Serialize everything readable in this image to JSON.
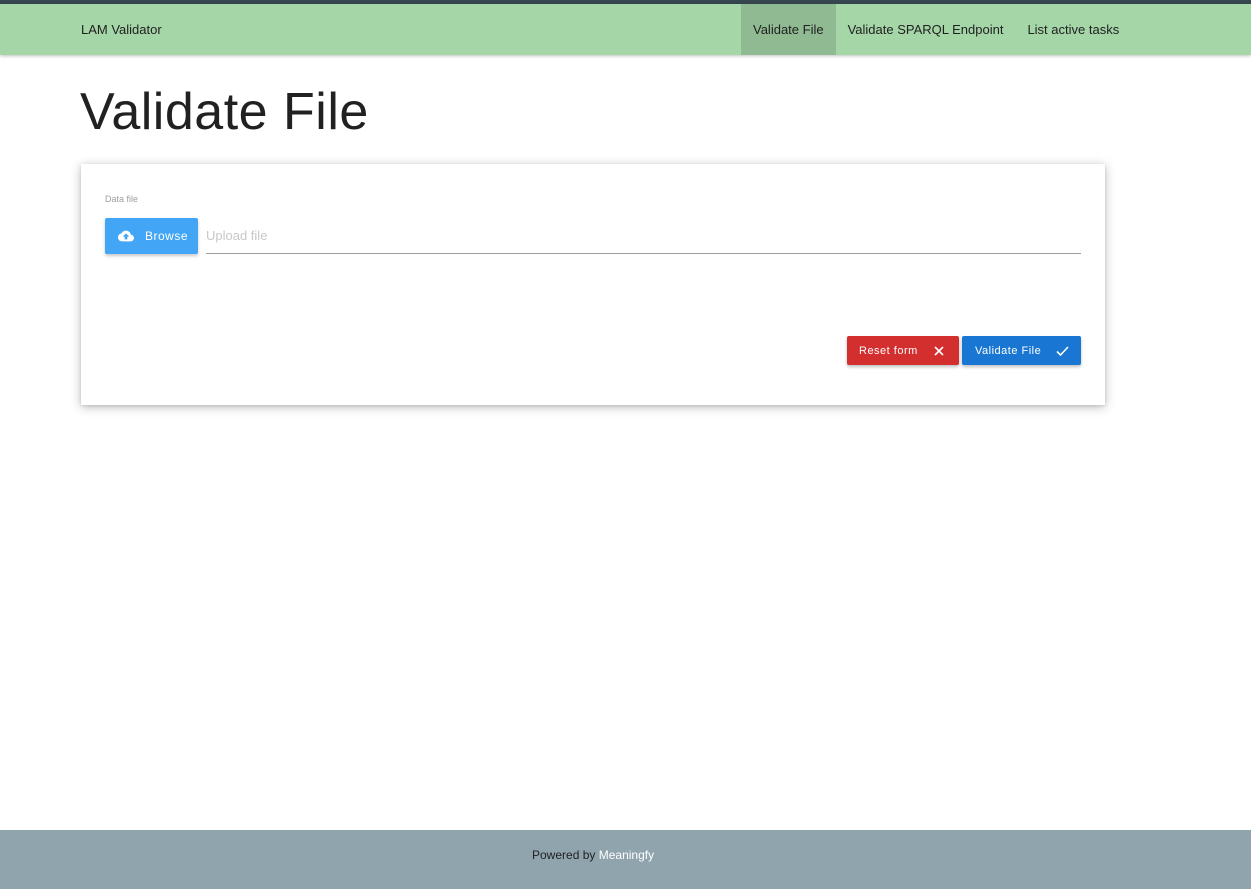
{
  "navbar": {
    "brand": "LAM Validator",
    "links": [
      {
        "label": "Validate File",
        "active": true
      },
      {
        "label": "Validate SPARQL Endpoint",
        "active": false
      },
      {
        "label": "List active tasks",
        "active": false
      }
    ]
  },
  "page": {
    "title": "Validate File"
  },
  "form": {
    "data_file_label": "Data file",
    "browse_label": "Browse",
    "upload_placeholder": "Upload file",
    "reset_label": "Reset form",
    "validate_label": "Validate File"
  },
  "footer": {
    "prefix": "Powered by",
    "link_label": "Meaningfy"
  },
  "colors": {
    "navbar_bg": "#a5d6a7",
    "nav_active_bg": "#90bb92",
    "browse_button": "#42a5f5",
    "reset_button": "#d32f2f",
    "validate_button": "#1976d2",
    "footer_bg": "#90a4ae"
  },
  "icons": {
    "browse": "cloud-upload-icon",
    "reset": "close-icon",
    "validate": "check-icon"
  }
}
